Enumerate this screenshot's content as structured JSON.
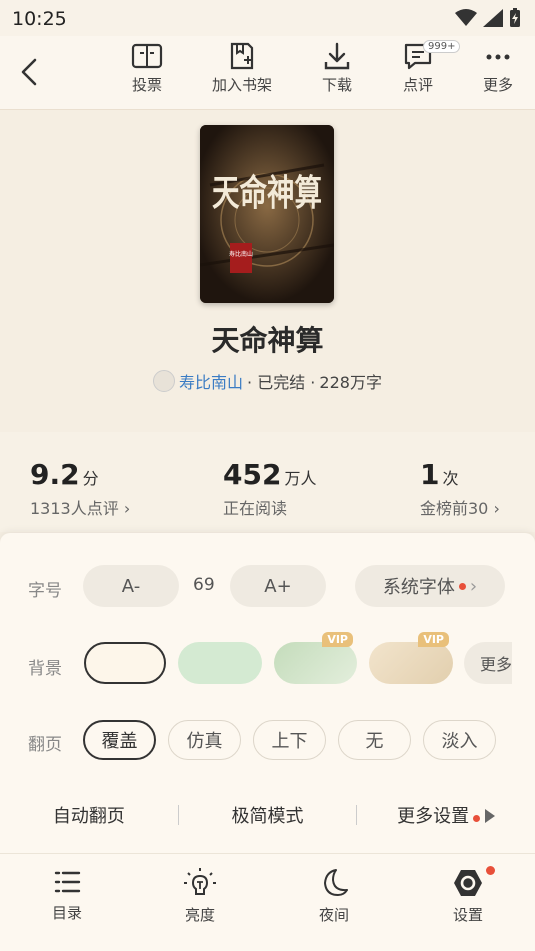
{
  "status": {
    "time": "10:25"
  },
  "toolbar": {
    "items": [
      {
        "label": "投票",
        "icon": "vote-icon"
      },
      {
        "label": "加入书架",
        "icon": "add-bookshelf-icon"
      },
      {
        "label": "下载",
        "icon": "download-icon"
      },
      {
        "label": "点评",
        "icon": "comment-icon",
        "badge": "999+"
      },
      {
        "label": "更多",
        "icon": "more-icon"
      }
    ]
  },
  "book": {
    "title": "天命神算",
    "cover_title": "天命神算",
    "cover_author": "寿比南山",
    "author": "寿比南山",
    "status": "· 已完结 ·",
    "words": "228万字"
  },
  "stats": {
    "score": {
      "value": "9.2",
      "unit": "分",
      "sub": "1313人点评"
    },
    "readers": {
      "value": "452",
      "unit": "万人",
      "sub": "正在阅读"
    },
    "rank": {
      "value": "1",
      "unit": "次",
      "sub": "金榜前30"
    }
  },
  "settings": {
    "font_label": "字号",
    "font_minus": "A-",
    "font_size": "69",
    "font_plus": "A+",
    "font_family": "系统字体",
    "bg_label": "背景",
    "bg_vip_badge": "VIP",
    "bg_more": "更多",
    "bg_colors": [
      "#fdf6ea",
      "#d4ead2",
      "#cfe2c7",
      "#efe1c9"
    ],
    "turn_label": "翻页",
    "turn_options": [
      "覆盖",
      "仿真",
      "上下",
      "无",
      "淡入"
    ],
    "auto_turn": "自动翻页",
    "minimal_mode": "极简模式",
    "more_settings": "更多设置"
  },
  "nav": {
    "items": [
      {
        "label": "目录",
        "icon": "catalog-icon"
      },
      {
        "label": "亮度",
        "icon": "brightness-icon"
      },
      {
        "label": "夜间",
        "icon": "night-mode-icon"
      },
      {
        "label": "设置",
        "icon": "settings-icon"
      }
    ]
  }
}
